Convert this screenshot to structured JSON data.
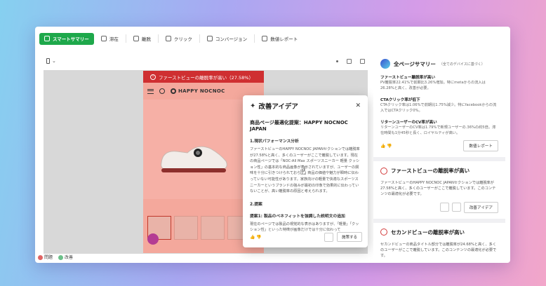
{
  "toolbar": {
    "items": [
      {
        "label": "スマートサマリー",
        "icon": "sparkle-icon"
      },
      {
        "label": "滞在",
        "icon": "eye-icon"
      },
      {
        "label": "離脱",
        "icon": "exit-icon"
      },
      {
        "label": "クリック",
        "icon": "pointer-icon"
      },
      {
        "label": "コンバージョン",
        "icon": "conversion-icon"
      },
      {
        "label": "数値レポート",
        "icon": "report-icon"
      }
    ]
  },
  "preview": {
    "alert": "ファーストビューの離脱率が高い（27.58%）",
    "brand": "HAPPY NOCNOC"
  },
  "legend": {
    "a": "問題",
    "b": "改善"
  },
  "popup": {
    "title": "改善アイデア",
    "subtitle": "商品ページ最適化提案：HAPPY NOCNOC JAPAN",
    "section1": "1.現状パフォーマンス分析",
    "para1": "ファーストビューのHAPPY NOCNOC JAPANセクションでは離脱率が27.58%と高く、多くのユーザーがここで離脱しています。現在の商品ページでは「NOC-All Max スポーツスニーカー 軽量 クッション性」の基本的な商品画像が表示されていますが、ユーザーの興味を十分に引きつけられておらず、商品の価値や魅力が瞬時に伝わっていない可能性があります。家族向けの軽量で快適なスポーツスニーカーというブランドの強みが最初の印象で効果的に伝わっていないことが、高い離脱率の原因と考えられます。",
    "section2": "2.提案",
    "section2_sub": "提案1: 製品のベネフィットを強調した説明文の追加",
    "para2": "現在のページでは製品の視覚的な表示はありますが、「軽量」「クッション性」といった特徴が画像だけでは十分に伝わって",
    "apply_label": "施策する"
  },
  "summary": {
    "title": "全ページサマリー",
    "scope": "（全てのデバイスに基づく）",
    "rows": [
      {
        "k": "ファーストビュー離脱率が高い",
        "v": "PV離脱率22.41%で前期比3.26%増加。特にmetaからの流入は26.28%と高く、改善が必要。"
      },
      {
        "k": "CTAクリック率が低下",
        "v": "CTAクリック率は1.06%で前期比1.75%減少。特にfacebookからの流入ではCTAクリック0%。"
      },
      {
        "k": "リターンユーザーのCV率が高い",
        "v": "リターンユーザーのCV率は1.79%で新規ユーザーの.36%の約5倍。滞在時間も1分45秒と長く、ロイヤルティが高い。"
      }
    ],
    "report_button": "数値レポート"
  },
  "issues": [
    {
      "title": "ファーストビューの離脱率が高い",
      "body": "ファーストビューのHAPPY NOCNOC JAPANセクションでは離脱率が27.58%と高く、多くのユーザーがここで離脱しています。このコンテンツの最適化が必要です。",
      "button": "改善アイデア"
    },
    {
      "title": "セカンドビューの離脱率が高い",
      "body": "セカンドビューの商品タイトル部分では離脱率が24.68%と高く、多くのユーザーがここで離脱しています。このコンテンツの最適化が必要です。"
    }
  ],
  "colors": {
    "primary_green": "#1ea84b",
    "alert_red": "#cf2f31",
    "overlay_pink": "#f4a89c"
  }
}
